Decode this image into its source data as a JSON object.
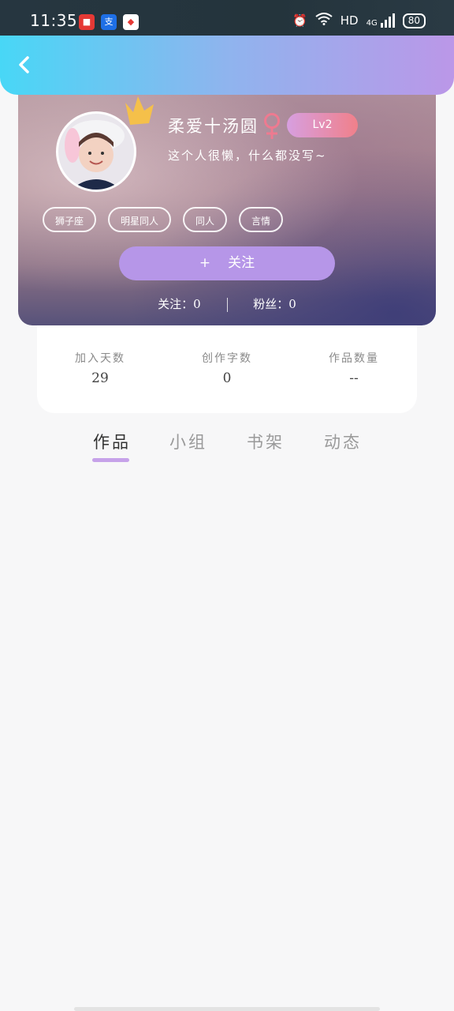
{
  "status_bar": {
    "time": "11:35",
    "apps": [
      "app-icon-1",
      "alipay-icon",
      "game-icon"
    ],
    "network_label": "HD",
    "signal_label": "4G",
    "battery": "80"
  },
  "profile": {
    "nickname": "柔爱十汤圆",
    "level": "Lv2",
    "signature": "这个人很懒，什么都没写~",
    "tags": [
      "狮子座",
      "明星同人",
      "同人",
      "言情"
    ],
    "follow_button": "关注",
    "follow_plus": "+",
    "following_label": "关注：0",
    "fans_label": "粉丝：0"
  },
  "info": {
    "join_days_label": "加入天数",
    "join_days_value": "29",
    "words_label": "创作字数",
    "words_value": "0",
    "works_label": "作品数量",
    "works_value": "--"
  },
  "tabs": [
    "作品",
    "小组",
    "书架",
    "动态"
  ],
  "colors": {
    "header_start": "#48d7f6",
    "header_end": "#bb97e8",
    "accent": "#b696e8",
    "level_badge_end": "#f0808a"
  }
}
